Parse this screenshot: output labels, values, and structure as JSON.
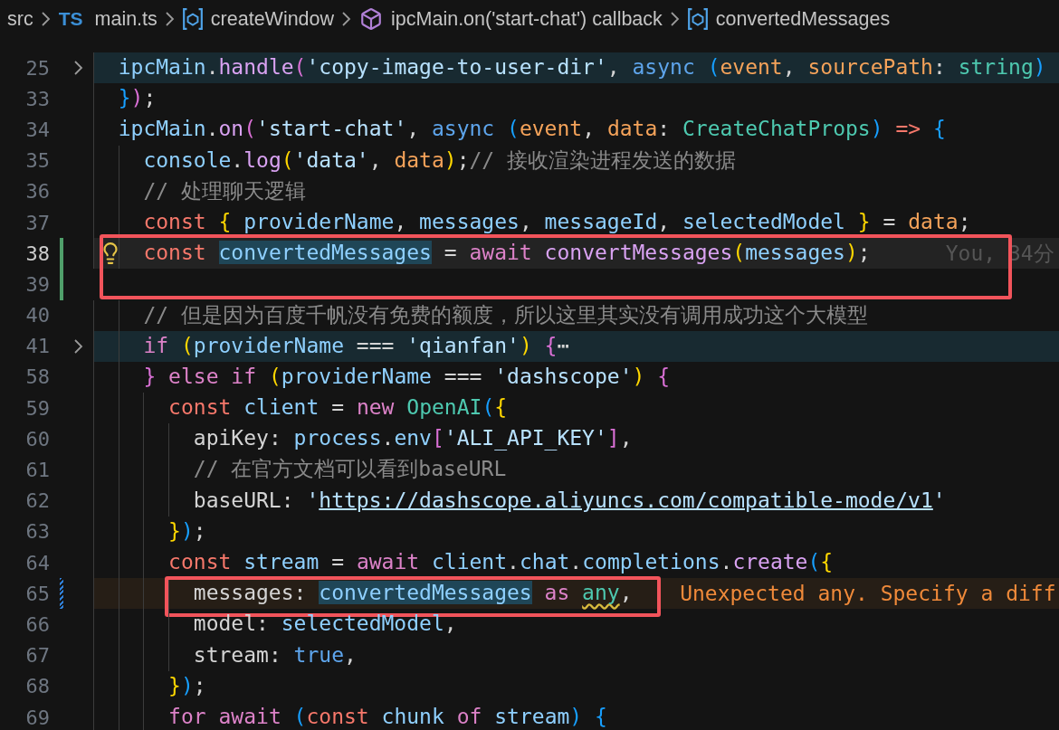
{
  "breadcrumb": [
    {
      "kind": "folder",
      "label": "src"
    },
    {
      "kind": "file",
      "badge": "TS",
      "label": "main.ts"
    },
    {
      "kind": "variable",
      "label": "createWindow"
    },
    {
      "kind": "method",
      "label": "ipcMain.on('start-chat') callback"
    },
    {
      "kind": "variable",
      "label": "convertedMessages"
    }
  ],
  "lines": [
    {
      "number": "25",
      "collapsed": true,
      "tokens": [
        {
          "text": "  ipcMain",
          "kind": "v"
        },
        {
          "text": ".",
          "kind": "p"
        },
        {
          "text": "handle",
          "kind": "f"
        },
        {
          "text": "(",
          "kind": "b2"
        },
        {
          "text": "'copy-image-to-user-dir'",
          "kind": "s"
        },
        {
          "text": ",",
          "kind": "p"
        },
        {
          "text": " async",
          "kind": "b"
        },
        {
          "text": " (",
          "kind": "b3"
        },
        {
          "text": "event",
          "kind": "a"
        },
        {
          "text": ",",
          "kind": "p"
        },
        {
          "text": " sourcePath",
          "kind": "a"
        },
        {
          "text": ":",
          "kind": "p"
        },
        {
          "text": " string",
          "kind": "t"
        },
        {
          "text": ")",
          "kind": "b3"
        }
      ]
    },
    {
      "number": "33",
      "tokens": [
        {
          "text": "  }",
          "kind": "b3"
        },
        {
          "text": ")",
          "kind": "b2"
        },
        {
          "text": ";",
          "kind": "p"
        }
      ]
    },
    {
      "number": "34",
      "tokens": [
        {
          "text": "  ipcMain",
          "kind": "v"
        },
        {
          "text": ".",
          "kind": "p"
        },
        {
          "text": "on",
          "kind": "f"
        },
        {
          "text": "(",
          "kind": "b2"
        },
        {
          "text": "'start-chat'",
          "kind": "s"
        },
        {
          "text": ",",
          "kind": "p"
        },
        {
          "text": " async",
          "kind": "b"
        },
        {
          "text": " (",
          "kind": "b3"
        },
        {
          "text": "event",
          "kind": "a"
        },
        {
          "text": ",",
          "kind": "p"
        },
        {
          "text": " data",
          "kind": "a"
        },
        {
          "text": ":",
          "kind": "p"
        },
        {
          "text": " CreateChatProps",
          "kind": "t"
        },
        {
          "text": ")",
          "kind": "b3"
        },
        {
          "text": " =>",
          "kind": "e"
        },
        {
          "text": " {",
          "kind": "b3"
        }
      ]
    },
    {
      "number": "35",
      "tokens": [
        {
          "text": "    console",
          "kind": "v"
        },
        {
          "text": ".",
          "kind": "p"
        },
        {
          "text": "log",
          "kind": "f"
        },
        {
          "text": "(",
          "kind": "b1"
        },
        {
          "text": "'data'",
          "kind": "s"
        },
        {
          "text": ",",
          "kind": "p"
        },
        {
          "text": " data",
          "kind": "a"
        },
        {
          "text": ")",
          "kind": "b1"
        },
        {
          "text": ";",
          "kind": "p"
        },
        {
          "text": "// 接收渲染进程发送的数据",
          "kind": "m"
        }
      ]
    },
    {
      "number": "36",
      "tokens": [
        {
          "text": "    // 处理聊天逻辑",
          "kind": "m"
        }
      ]
    },
    {
      "number": "37",
      "tokens": [
        {
          "text": "    const",
          "kind": "c"
        },
        {
          "text": " {",
          "kind": "b1"
        },
        {
          "text": " providerName",
          "kind": "v"
        },
        {
          "text": ",",
          "kind": "p"
        },
        {
          "text": " messages",
          "kind": "v"
        },
        {
          "text": ",",
          "kind": "p"
        },
        {
          "text": " messageId",
          "kind": "v"
        },
        {
          "text": ",",
          "kind": "p"
        },
        {
          "text": " selectedModel",
          "kind": "v"
        },
        {
          "text": " }",
          "kind": "b1"
        },
        {
          "text": " =",
          "kind": "p"
        },
        {
          "text": " data",
          "kind": "a"
        },
        {
          "text": ";",
          "kind": "p"
        }
      ]
    },
    {
      "number": "38",
      "current": true,
      "boxed": true,
      "added": true,
      "lightbulb": true,
      "blame": "You, 34分",
      "tokens": [
        {
          "text": "    const",
          "kind": "c"
        },
        {
          "text": " convertedMessages",
          "kind": "h"
        },
        {
          "text": " =",
          "kind": "p"
        },
        {
          "text": " await",
          "kind": "k"
        },
        {
          "text": " convertMessages",
          "kind": "f"
        },
        {
          "text": "(",
          "kind": "b1"
        },
        {
          "text": "messages",
          "kind": "v"
        },
        {
          "text": ")",
          "kind": "b1"
        },
        {
          "text": ";",
          "kind": "p"
        }
      ]
    },
    {
      "number": "39",
      "boxed": true,
      "added": true
    },
    {
      "number": "40",
      "tokens": [
        {
          "text": "    // 但是因为百度千帆没有免费的额度，所以这里其实没有调用成功这个大模型",
          "kind": "m"
        }
      ]
    },
    {
      "number": "41",
      "collapsed": true,
      "tokens": [
        {
          "text": "    if",
          "kind": "k"
        },
        {
          "text": " (",
          "kind": "b1"
        },
        {
          "text": "providerName",
          "kind": "v"
        },
        {
          "text": " ===",
          "kind": "p"
        },
        {
          "text": " 'qianfan'",
          "kind": "s"
        },
        {
          "text": ")",
          "kind": "b1"
        },
        {
          "text": " {",
          "kind": "b2"
        },
        {
          "text": "⋯",
          "kind": "p"
        }
      ]
    },
    {
      "number": "58",
      "tokens": [
        {
          "text": "    }",
          "kind": "b2"
        },
        {
          "text": " else",
          "kind": "k"
        },
        {
          "text": " if",
          "kind": "k"
        },
        {
          "text": " (",
          "kind": "b1"
        },
        {
          "text": "providerName",
          "kind": "v"
        },
        {
          "text": " ===",
          "kind": "p"
        },
        {
          "text": " 'dashscope'",
          "kind": "s"
        },
        {
          "text": ")",
          "kind": "b1"
        },
        {
          "text": " {",
          "kind": "b2"
        }
      ]
    },
    {
      "number": "59",
      "tokens": [
        {
          "text": "      const",
          "kind": "c"
        },
        {
          "text": " client",
          "kind": "v"
        },
        {
          "text": " =",
          "kind": "p"
        },
        {
          "text": " new",
          "kind": "k"
        },
        {
          "text": " OpenAI",
          "kind": "t"
        },
        {
          "text": "(",
          "kind": "b3"
        },
        {
          "text": "{",
          "kind": "b1"
        }
      ]
    },
    {
      "number": "60",
      "tokens": [
        {
          "text": "        apiKey",
          "kind": "p"
        },
        {
          "text": ":",
          "kind": "p"
        },
        {
          "text": " process",
          "kind": "v"
        },
        {
          "text": ".",
          "kind": "p"
        },
        {
          "text": "env",
          "kind": "v"
        },
        {
          "text": "[",
          "kind": "b2"
        },
        {
          "text": "'ALI_API_KEY'",
          "kind": "s"
        },
        {
          "text": "]",
          "kind": "b2"
        },
        {
          "text": ",",
          "kind": "p"
        }
      ]
    },
    {
      "number": "61",
      "tokens": [
        {
          "text": "        // 在官方文档可以看到baseURL",
          "kind": "m"
        }
      ]
    },
    {
      "number": "62",
      "tokens": [
        {
          "text": "        baseURL",
          "kind": "p"
        },
        {
          "text": ":",
          "kind": "p"
        },
        {
          "text": " '",
          "kind": "s"
        },
        {
          "text": "https://dashscope.aliyuncs.com/compatible-mode/v1",
          "kind": "u"
        },
        {
          "text": "'",
          "kind": "s"
        }
      ]
    },
    {
      "number": "63",
      "tokens": [
        {
          "text": "      }",
          "kind": "b1"
        },
        {
          "text": ")",
          "kind": "b3"
        },
        {
          "text": ";",
          "kind": "p"
        }
      ]
    },
    {
      "number": "64",
      "tokens": [
        {
          "text": "      const",
          "kind": "c"
        },
        {
          "text": " stream",
          "kind": "v"
        },
        {
          "text": " =",
          "kind": "p"
        },
        {
          "text": " await",
          "kind": "k"
        },
        {
          "text": " client",
          "kind": "v"
        },
        {
          "text": ".",
          "kind": "p"
        },
        {
          "text": "chat",
          "kind": "v"
        },
        {
          "text": ".",
          "kind": "p"
        },
        {
          "text": "completions",
          "kind": "v"
        },
        {
          "text": ".",
          "kind": "p"
        },
        {
          "text": "create",
          "kind": "f"
        },
        {
          "text": "(",
          "kind": "b3"
        },
        {
          "text": "{",
          "kind": "b1"
        }
      ]
    },
    {
      "number": "65",
      "boxed": true,
      "modified": true,
      "diagnostic": "Unexpected any. Specify a diff",
      "tokens": [
        {
          "text": "        messages",
          "kind": "p"
        },
        {
          "text": ":",
          "kind": "p"
        },
        {
          "text": " convertedMessages",
          "kind": "h"
        },
        {
          "text": " as",
          "kind": "k"
        },
        {
          "text": " any",
          "kind": "q"
        },
        {
          "text": ",",
          "kind": "p"
        }
      ]
    },
    {
      "number": "66",
      "tokens": [
        {
          "text": "        model",
          "kind": "p"
        },
        {
          "text": ":",
          "kind": "p"
        },
        {
          "text": " selectedModel",
          "kind": "v"
        },
        {
          "text": ",",
          "kind": "p"
        }
      ]
    },
    {
      "number": "67",
      "tokens": [
        {
          "text": "        stream",
          "kind": "p"
        },
        {
          "text": ":",
          "kind": "p"
        },
        {
          "text": " true",
          "kind": "b"
        },
        {
          "text": ",",
          "kind": "p"
        }
      ]
    },
    {
      "number": "68",
      "tokens": [
        {
          "text": "      }",
          "kind": "b1"
        },
        {
          "text": ")",
          "kind": "b3"
        },
        {
          "text": ";",
          "kind": "p"
        }
      ]
    },
    {
      "number": "69",
      "tokens": [
        {
          "text": "      for",
          "kind": "k"
        },
        {
          "text": " await",
          "kind": "k"
        },
        {
          "text": " (",
          "kind": "b3"
        },
        {
          "text": "const",
          "kind": "c"
        },
        {
          "text": " chunk",
          "kind": "v"
        },
        {
          "text": " of",
          "kind": "k"
        },
        {
          "text": " stream",
          "kind": "v"
        },
        {
          "text": ")",
          "kind": "b3"
        },
        {
          "text": " {",
          "kind": "b3"
        }
      ]
    }
  ]
}
